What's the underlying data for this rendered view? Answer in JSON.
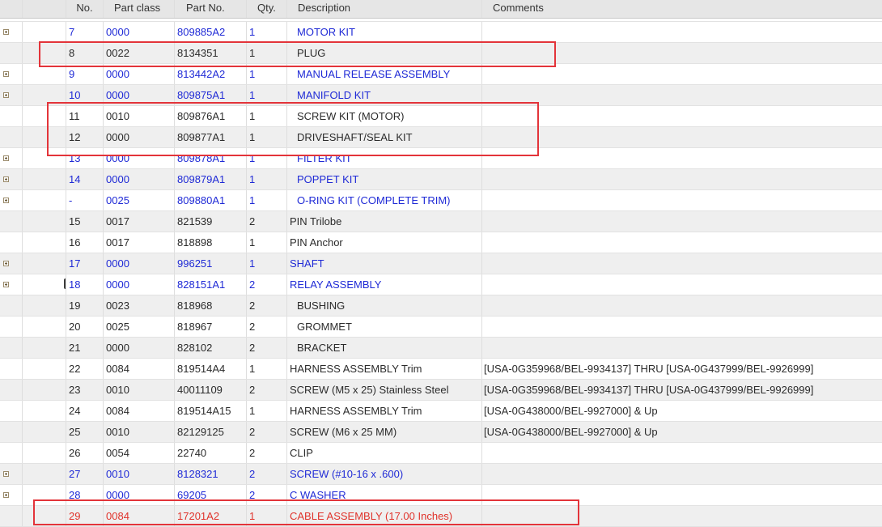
{
  "columns": {
    "no": "No.",
    "part_class": "Part class",
    "part_no": "Part No.",
    "qty": "Qty.",
    "description": "Description",
    "comments": "Comments"
  },
  "header_icon": "folder-icon",
  "rows": [
    {
      "no": "7",
      "part_class": "0000",
      "part_no": "809885A2",
      "qty": "1",
      "description": "MOTOR KIT",
      "comments": "",
      "expandable": true,
      "style": "link",
      "indent": true
    },
    {
      "no": "8",
      "part_class": "0022",
      "part_no": "8134351",
      "qty": "1",
      "description": "PLUG",
      "comments": "",
      "expandable": false,
      "style": "normal",
      "indent": true
    },
    {
      "no": "9",
      "part_class": "0000",
      "part_no": "813442A2",
      "qty": "1",
      "description": "MANUAL RELEASE ASSEMBLY",
      "comments": "",
      "expandable": true,
      "style": "link",
      "indent": true
    },
    {
      "no": "10",
      "part_class": "0000",
      "part_no": "809875A1",
      "qty": "1",
      "description": "MANIFOLD KIT",
      "comments": "",
      "expandable": true,
      "style": "link",
      "indent": true
    },
    {
      "no": "11",
      "part_class": "0010",
      "part_no": "809876A1",
      "qty": "1",
      "description": "SCREW KIT (MOTOR)",
      "comments": "",
      "expandable": false,
      "style": "normal",
      "indent": true
    },
    {
      "no": "12",
      "part_class": "0000",
      "part_no": "809877A1",
      "qty": "1",
      "description": "DRIVESHAFT/SEAL KIT",
      "comments": "",
      "expandable": false,
      "style": "normal",
      "indent": true
    },
    {
      "no": "13",
      "part_class": "0000",
      "part_no": "809878A1",
      "qty": "1",
      "description": "FILTER KIT",
      "comments": "",
      "expandable": true,
      "style": "link",
      "indent": true
    },
    {
      "no": "14",
      "part_class": "0000",
      "part_no": "809879A1",
      "qty": "1",
      "description": "POPPET KIT",
      "comments": "",
      "expandable": true,
      "style": "link",
      "indent": true
    },
    {
      "no": "-",
      "part_class": "0025",
      "part_no": "809880A1",
      "qty": "1",
      "description": "O-RING KIT (COMPLETE TRIM)",
      "comments": "",
      "expandable": true,
      "style": "link",
      "indent": true
    },
    {
      "no": "15",
      "part_class": "0017",
      "part_no": "821539",
      "qty": "2",
      "description": "PIN Trilobe",
      "comments": "",
      "expandable": false,
      "style": "normal",
      "indent": false
    },
    {
      "no": "16",
      "part_class": "0017",
      "part_no": "818898",
      "qty": "1",
      "description": "PIN Anchor",
      "comments": "",
      "expandable": false,
      "style": "normal",
      "indent": false
    },
    {
      "no": "17",
      "part_class": "0000",
      "part_no": "996251",
      "qty": "1",
      "description": "SHAFT",
      "comments": "",
      "expandable": true,
      "style": "link",
      "indent": false
    },
    {
      "no": "18",
      "part_class": "0000",
      "part_no": "828151A1",
      "qty": "2",
      "description": "RELAY ASSEMBLY",
      "comments": "",
      "expandable": true,
      "style": "link",
      "indent": false,
      "camera": true
    },
    {
      "no": "19",
      "part_class": "0023",
      "part_no": "818968",
      "qty": "2",
      "description": "BUSHING",
      "comments": "",
      "expandable": false,
      "style": "normal",
      "indent": true
    },
    {
      "no": "20",
      "part_class": "0025",
      "part_no": "818967",
      "qty": "2",
      "description": "GROMMET",
      "comments": "",
      "expandable": false,
      "style": "normal",
      "indent": true
    },
    {
      "no": "21",
      "part_class": "0000",
      "part_no": "828102",
      "qty": "2",
      "description": "BRACKET",
      "comments": "",
      "expandable": false,
      "style": "normal",
      "indent": true
    },
    {
      "no": "22",
      "part_class": "0084",
      "part_no": "819514A4",
      "qty": "1",
      "description": "HARNESS ASSEMBLY Trim",
      "comments": "[USA-0G359968/BEL-9934137] THRU [USA-0G437999/BEL-9926999]",
      "expandable": false,
      "style": "normal",
      "indent": false
    },
    {
      "no": "23",
      "part_class": "0010",
      "part_no": "40011109",
      "qty": "2",
      "description": "SCREW (M5 x 25) Stainless Steel",
      "comments": "[USA-0G359968/BEL-9934137] THRU [USA-0G437999/BEL-9926999]",
      "expandable": false,
      "style": "normal",
      "indent": false
    },
    {
      "no": "24",
      "part_class": "0084",
      "part_no": "819514A15",
      "qty": "1",
      "description": "HARNESS ASSEMBLY Trim",
      "comments": "[USA-0G438000/BEL-9927000] & Up",
      "expandable": false,
      "style": "normal",
      "indent": false
    },
    {
      "no": "25",
      "part_class": "0010",
      "part_no": "82129125",
      "qty": "2",
      "description": "SCREW (M6 x 25 MM)",
      "comments": "[USA-0G438000/BEL-9927000] & Up",
      "expandable": false,
      "style": "normal",
      "indent": false
    },
    {
      "no": "26",
      "part_class": "0054",
      "part_no": "22740",
      "qty": "2",
      "description": "CLIP",
      "comments": "",
      "expandable": false,
      "style": "normal",
      "indent": false
    },
    {
      "no": "27",
      "part_class": "0010",
      "part_no": "8128321",
      "qty": "2",
      "description": "SCREW (#10-16 x .600)",
      "comments": "",
      "expandable": true,
      "style": "link",
      "indent": false
    },
    {
      "no": "28",
      "part_class": "0000",
      "part_no": "69205",
      "qty": "2",
      "description": "C WASHER",
      "comments": "",
      "expandable": true,
      "style": "link",
      "indent": false
    },
    {
      "no": "29",
      "part_class": "0084",
      "part_no": "17201A2",
      "qty": "1",
      "description": "CABLE ASSEMBLY (17.00 Inches)",
      "comments": "",
      "expandable": false,
      "style": "red",
      "indent": false
    }
  ],
  "highlight_color": "#e3343a",
  "link_color": "#1f2ad6",
  "alert_color": "#e0332b"
}
